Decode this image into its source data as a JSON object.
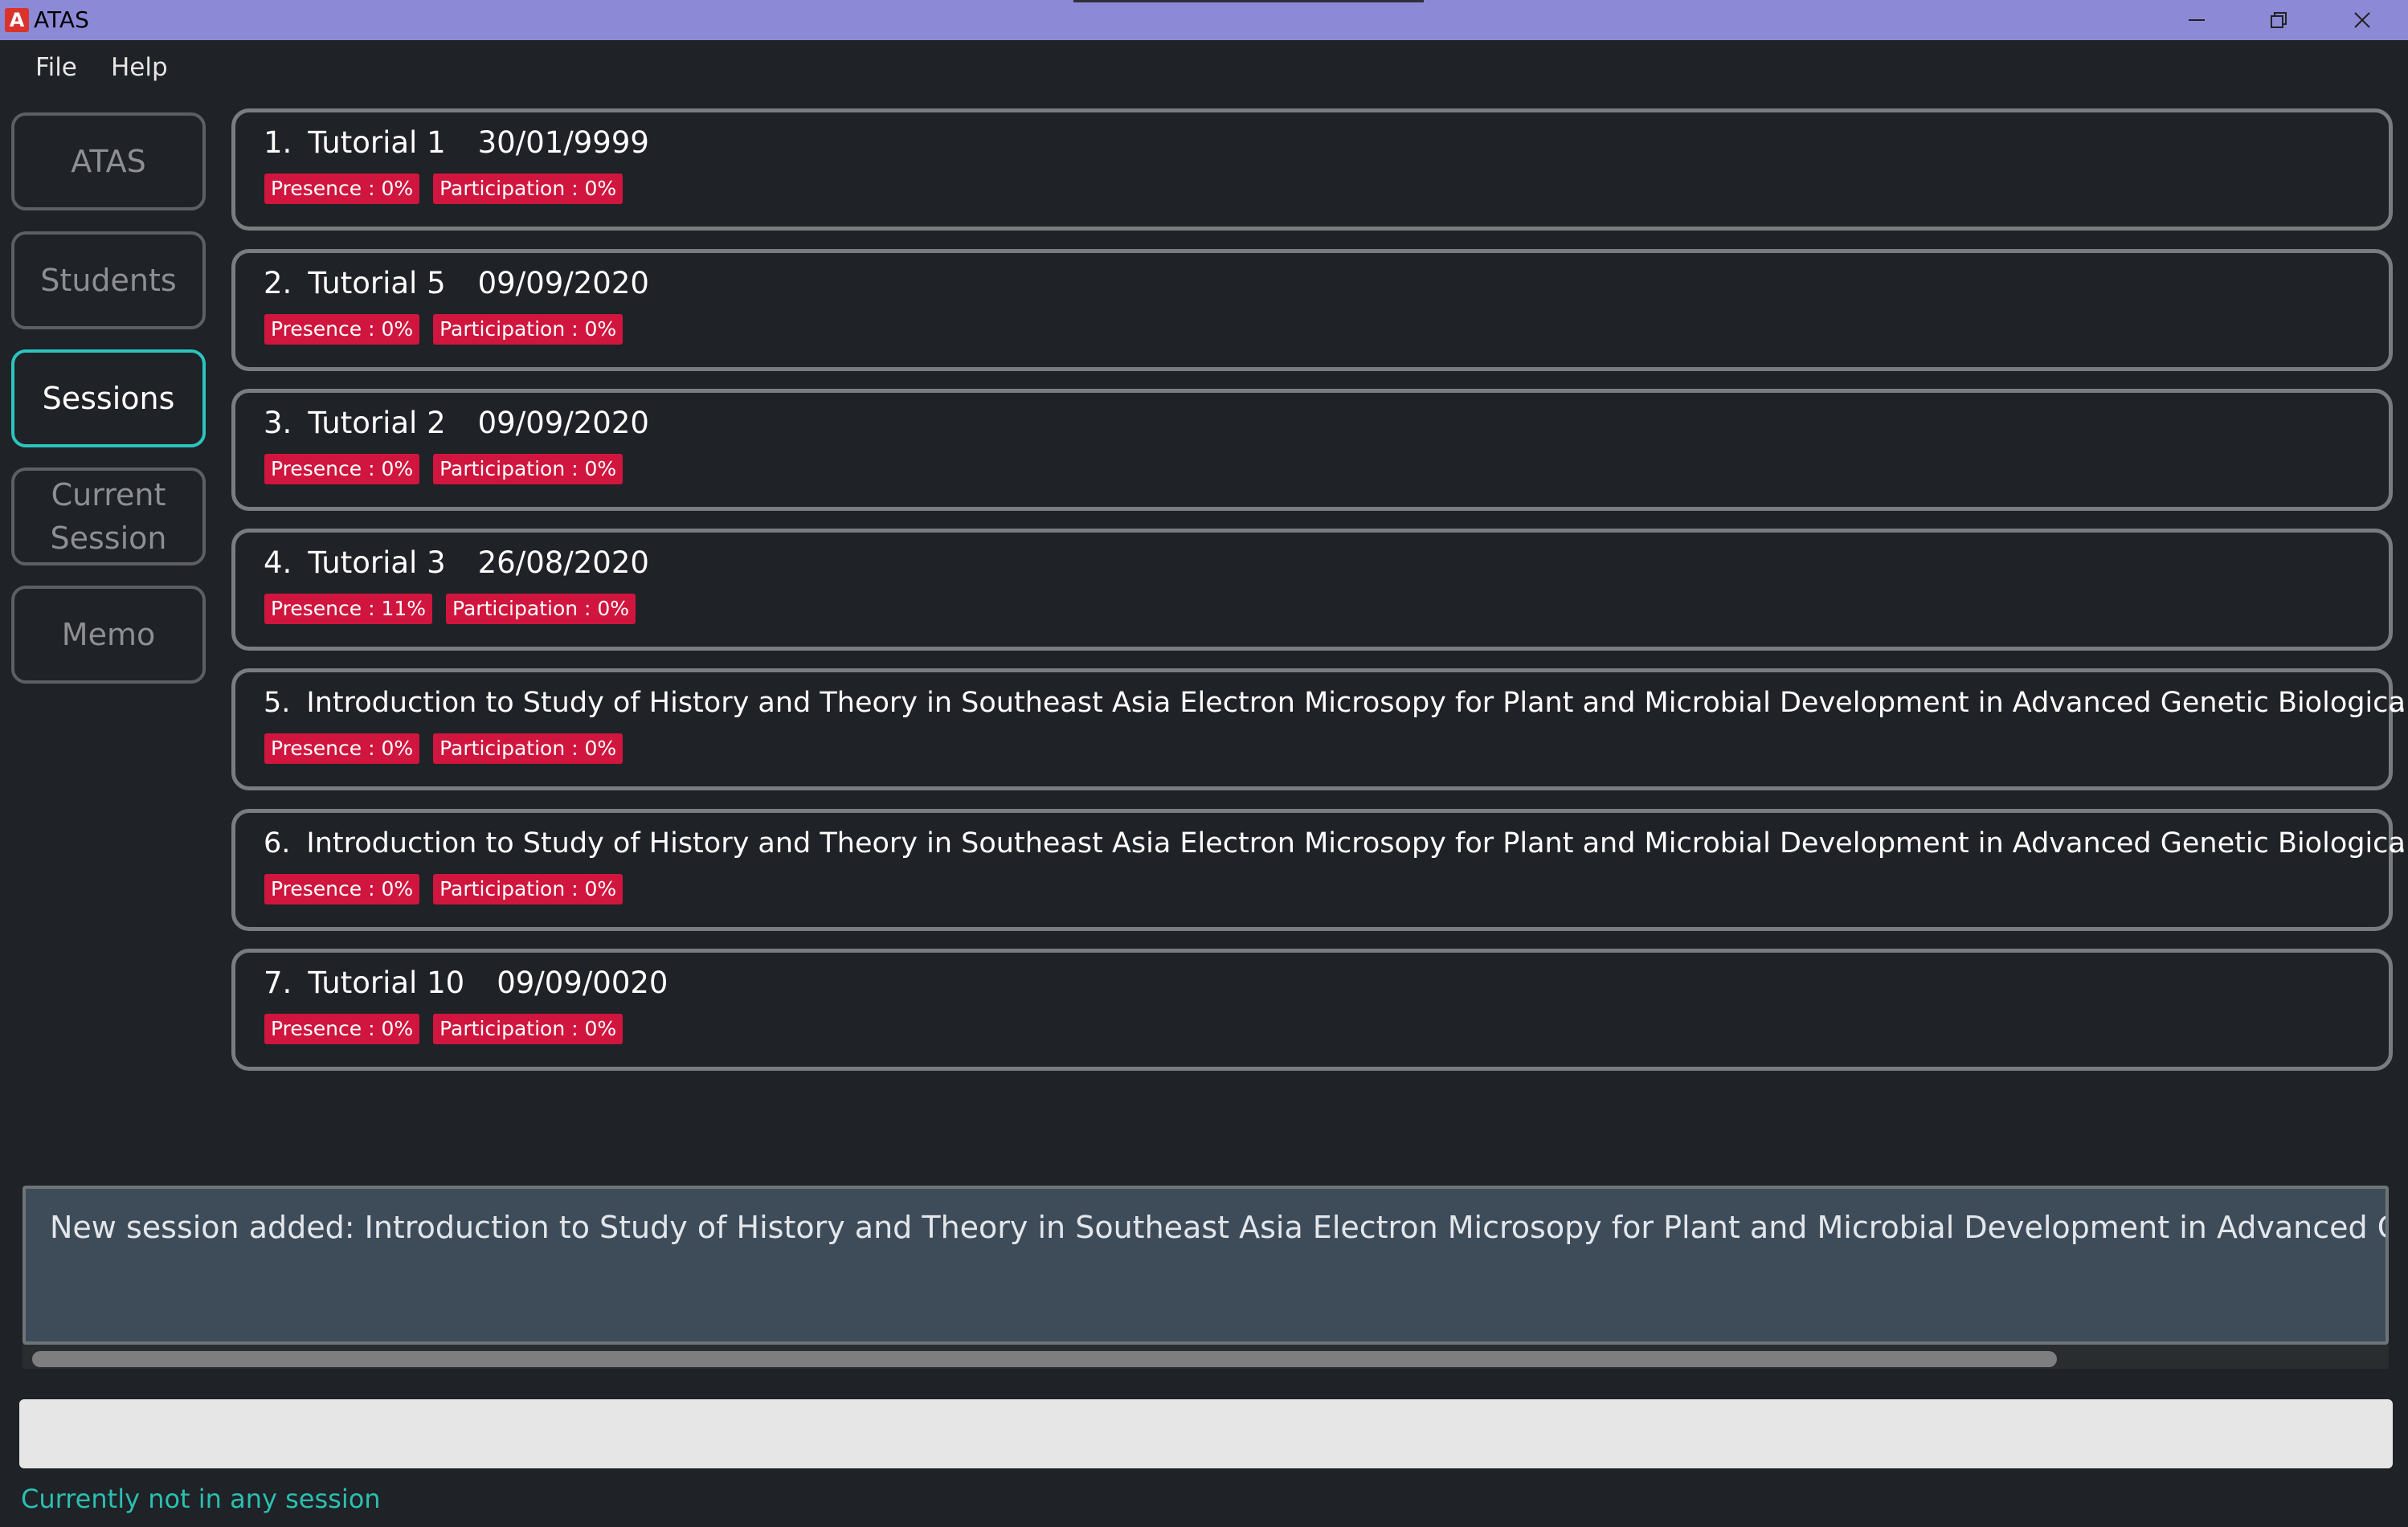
{
  "window": {
    "title": "ATAS",
    "icon_letter": "A",
    "controls": [
      "minimize-icon",
      "restore-icon",
      "close-icon"
    ]
  },
  "menu": {
    "file": "File",
    "help": "Help"
  },
  "sidebar": {
    "items": [
      {
        "label": "ATAS",
        "active": false
      },
      {
        "label": "Students",
        "active": false
      },
      {
        "label": "Sessions",
        "active": true
      },
      {
        "label": "Current Session",
        "active": false
      },
      {
        "label": "Memo",
        "active": false
      }
    ]
  },
  "sessions": [
    {
      "index": "1.",
      "name": "Tutorial 1",
      "date": "30/01/9999",
      "presence": "Presence : 0%",
      "participation": "Participation : 0%"
    },
    {
      "index": "2.",
      "name": "Tutorial 5",
      "date": "09/09/2020",
      "presence": "Presence : 0%",
      "participation": "Participation : 0%"
    },
    {
      "index": "3.",
      "name": "Tutorial 2",
      "date": "09/09/2020",
      "presence": "Presence : 0%",
      "participation": "Participation : 0%"
    },
    {
      "index": "4.",
      "name": "Tutorial 3",
      "date": "26/08/2020",
      "presence": "Presence : 11%",
      "participation": "Participation : 0%"
    },
    {
      "index": "5.",
      "name": "Introduction to Study of History and Theory in Southeast Asia Electron Microsopy for Plant and Microbial Development in Advanced Genetic Biological S...",
      "date": "",
      "overflow": "...",
      "presence": "Presence : 0%",
      "participation": "Participation : 0%"
    },
    {
      "index": "6.",
      "name": "Introduction to Study of History and Theory in Southeast Asia Electron Microsopy for Plant and Microbial Development in Advanced Genetic Biological S...",
      "date": "",
      "overflow": "...",
      "presence": "Presence : 0%",
      "participation": "Participation : 0%"
    },
    {
      "index": "7.",
      "name": "Tutorial 10",
      "date": "09/09/0020",
      "presence": "Presence : 0%",
      "participation": "Participation : 0%"
    }
  ],
  "result": {
    "text": "New session added: Introduction to Study of History and Theory in Southeast Asia Electron Microsopy for Plant and Microbial Development in Advanced Genetic Biological Science"
  },
  "command": {
    "value": "",
    "placeholder": ""
  },
  "status": {
    "text": "Currently not in any session"
  },
  "colors": {
    "titlebar": "#8c8ad7",
    "background": "#1f2226",
    "active_border": "#2cc4c0",
    "badge": "#d0163e",
    "status_text": "#2bbfb1",
    "result_bg": "#3e4c5a"
  }
}
